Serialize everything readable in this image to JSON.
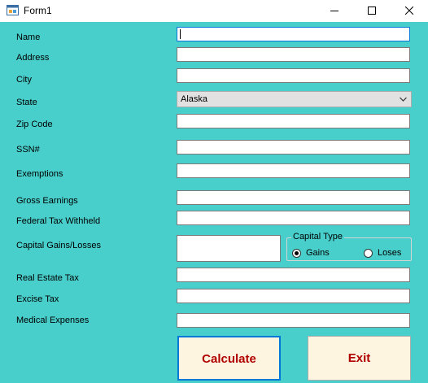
{
  "window": {
    "title": "Form1",
    "controls": [
      "minimize",
      "maximize",
      "close"
    ]
  },
  "fields": [
    {
      "label": "Name",
      "value": ""
    },
    {
      "label": "Address",
      "value": ""
    },
    {
      "label": "City",
      "value": ""
    },
    {
      "label": "State",
      "value": "Alaska"
    },
    {
      "label": "Zip Code",
      "value": ""
    },
    {
      "label": "SSN#",
      "value": ""
    },
    {
      "label": "Exemptions",
      "value": ""
    },
    {
      "label": "Gross Earnings",
      "value": ""
    },
    {
      "label": "Federal Tax Withheld",
      "value": ""
    },
    {
      "label": "Capital Gains/Losses",
      "value": ""
    },
    {
      "label": "Real Estate Tax",
      "value": ""
    },
    {
      "label": "Excise Tax",
      "value": ""
    },
    {
      "label": "Medical Expenses",
      "value": ""
    }
  ],
  "capital_type": {
    "title": "Capital Type",
    "options": [
      {
        "label": "Gains",
        "selected": true
      },
      {
        "label": "Loses",
        "selected": false
      }
    ]
  },
  "buttons": {
    "calculate": "Calculate",
    "exit": "Exit"
  },
  "colors": {
    "background": "#48CFCB",
    "button_face": "#FDF5E0",
    "button_text": "#B00000",
    "focus_border": "#0078D7"
  }
}
